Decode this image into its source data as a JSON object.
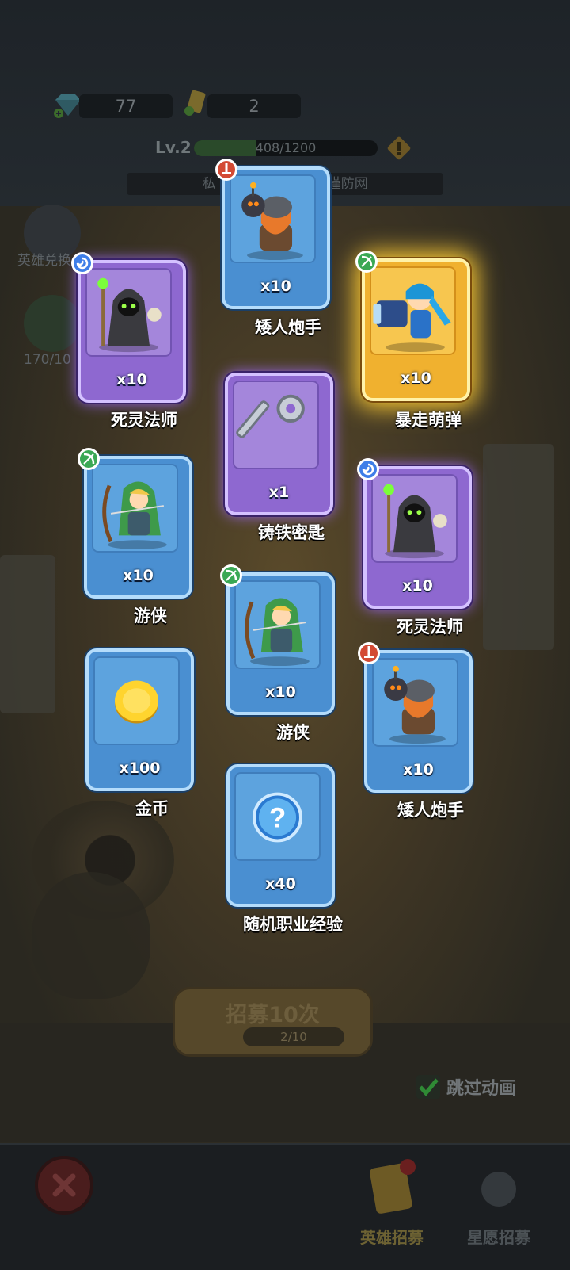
{
  "hud": {
    "gems": "77",
    "tickets": "2",
    "level": "Lv.2",
    "xp": "408/1200",
    "xp_fraction": 0.34,
    "notice": "私下交易买卖 链接，谨防网",
    "hero_exchange": "英雄兑换",
    "side_count": "170/10"
  },
  "rewards": [
    {
      "name": "死灵法师",
      "qty": "x10",
      "rarity": "purple",
      "class_icon": "swirl-icon",
      "art": "necromancer"
    },
    {
      "name": "矮人炮手",
      "qty": "x10",
      "rarity": "blue",
      "class_icon": "dagger-icon",
      "art": "dwarf-gunner"
    },
    {
      "name": "暴走萌弹",
      "qty": "x10",
      "rarity": "gold",
      "class_icon": "bow-icon",
      "art": "cannon-girl"
    },
    {
      "name": "铸铁密匙",
      "qty": "x1",
      "rarity": "purple",
      "class_icon": "",
      "art": "iron-key"
    },
    {
      "name": "游侠",
      "qty": "x10",
      "rarity": "blue",
      "class_icon": "bow-icon",
      "art": "ranger"
    },
    {
      "name": "死灵法师",
      "qty": "x10",
      "rarity": "purple",
      "class_icon": "swirl-icon",
      "art": "necromancer"
    },
    {
      "name": "游侠",
      "qty": "x10",
      "rarity": "blue",
      "class_icon": "bow-icon",
      "art": "ranger"
    },
    {
      "name": "金币",
      "qty": "x100",
      "rarity": "blue",
      "class_icon": "",
      "art": "gold-coin"
    },
    {
      "name": "矮人炮手",
      "qty": "x10",
      "rarity": "blue",
      "class_icon": "dagger-icon",
      "art": "dwarf-gunner"
    },
    {
      "name": "随机职业经验",
      "qty": "x40",
      "rarity": "blue",
      "class_icon": "",
      "art": "random-exp"
    }
  ],
  "recruit": {
    "label": "招募10次",
    "progress": "2/10"
  },
  "skip_animation": {
    "label": "跳过动画",
    "checked": true
  },
  "tabs": {
    "hero_recruit": "英雄招募",
    "wish_recruit": "星愿招募"
  },
  "colors": {
    "blue_card": "#4a8fd1",
    "purple_card": "#8e68d0",
    "gold_card": "#f0b12f"
  }
}
